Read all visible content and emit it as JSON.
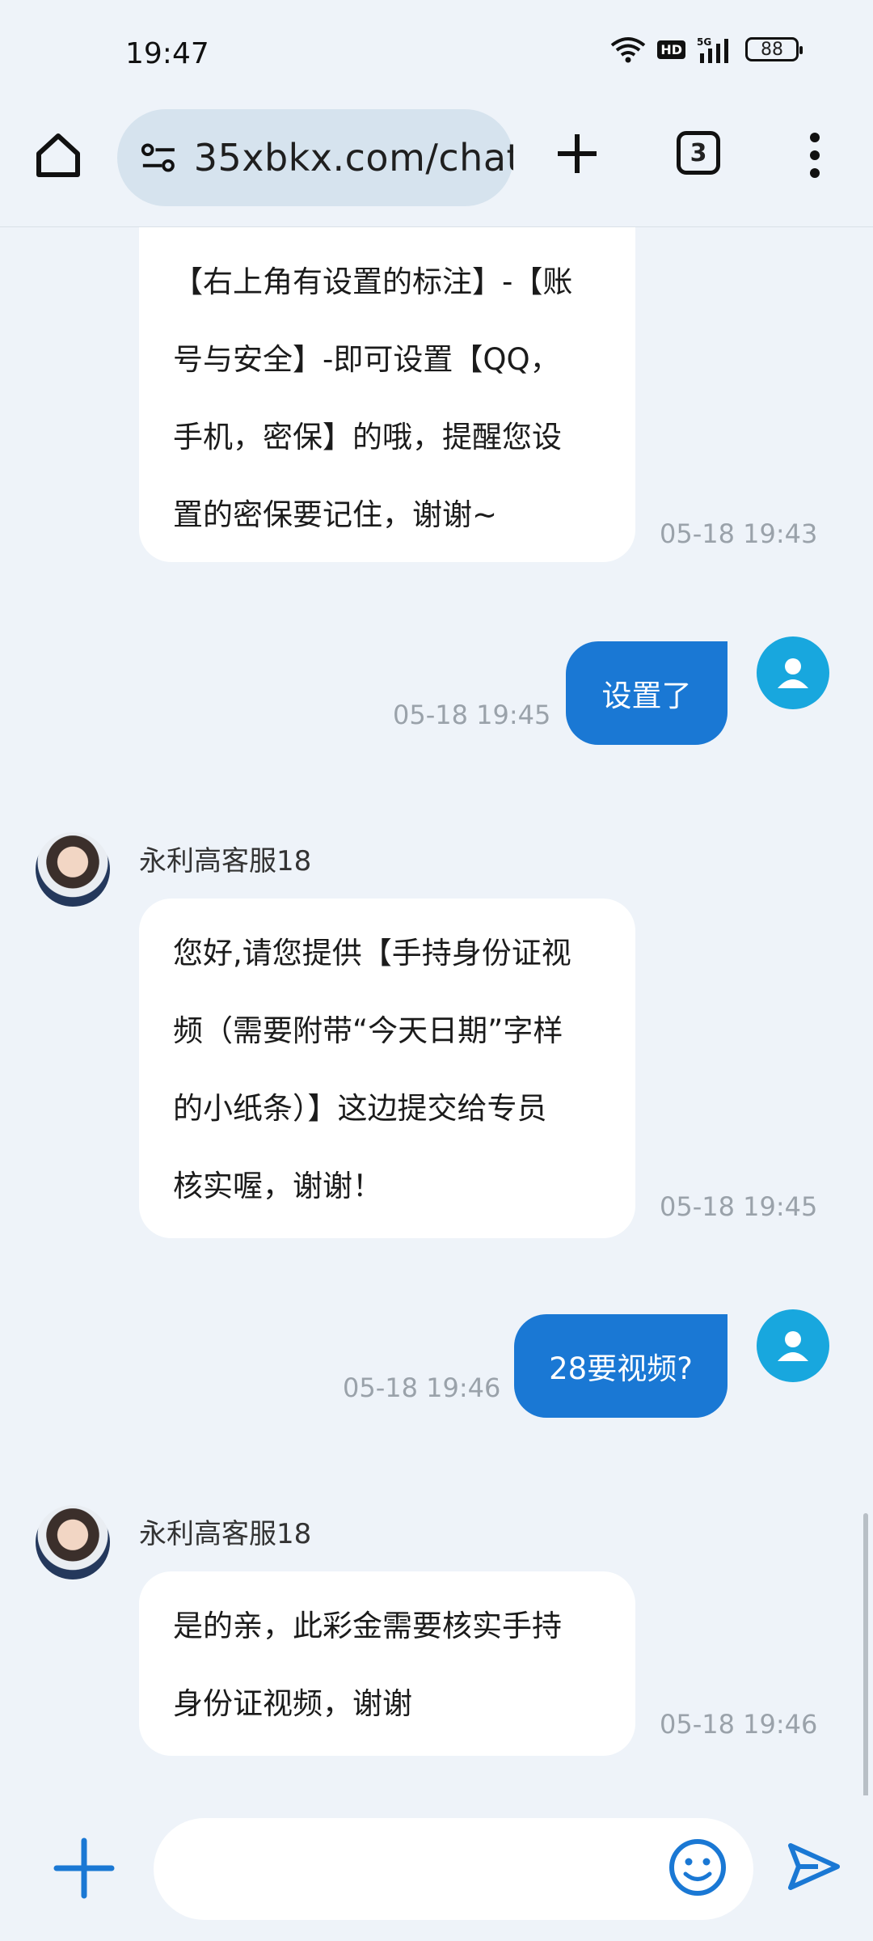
{
  "status_bar": {
    "time": "19:47",
    "network": "5G",
    "hd_label": "HD",
    "battery": "88"
  },
  "browser": {
    "url": "35xbkx.com/chat",
    "tab_count": "3"
  },
  "messages": [
    {
      "side": "left",
      "sender": "",
      "lines": [
        "【右上角有设置的标注】-【账",
        "号与安全】-即可设置【QQ，",
        "手机，密保】的哦，提醒您设",
        "置的密保要记住，谢谢~"
      ],
      "time": "05-18 19:43"
    },
    {
      "side": "right",
      "text": "设置了",
      "time": "05-18 19:45"
    },
    {
      "side": "left",
      "sender": "永利高客服18",
      "lines": [
        "您好,请您提供【手持身份证视",
        "频（需要附带“今天日期”字样",
        "的小纸条）】这边提交给专员",
        "核实喔，谢谢！"
      ],
      "time": "05-18 19:45"
    },
    {
      "side": "right",
      "text": "28要视频?",
      "time": "05-18 19:46"
    },
    {
      "side": "left",
      "sender": "永利高客服18",
      "lines": [
        "是的亲，此彩金需要核实手持",
        "身份证视频，谢谢"
      ],
      "time": "05-18 19:46"
    }
  ],
  "input": {
    "placeholder": ""
  },
  "colors": {
    "user_bubble": "#1a78d4",
    "avatar_user": "#18a7de",
    "icon_blue": "#1a78d4"
  }
}
